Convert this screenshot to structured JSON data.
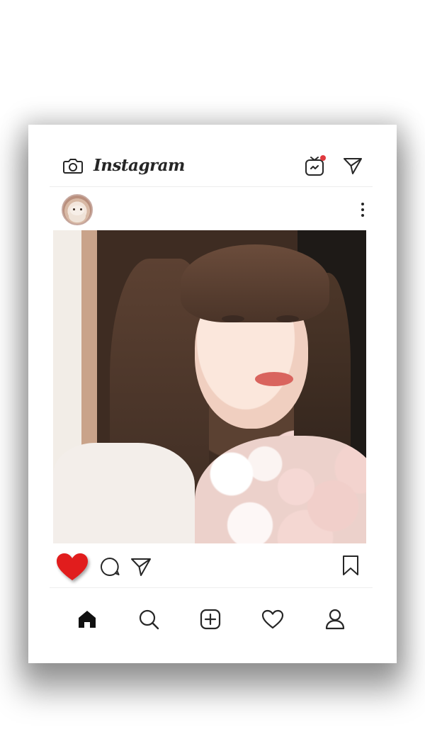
{
  "app": {
    "brand": "Instagram"
  },
  "topbar": {
    "icons": [
      "camera-icon",
      "igtv-icon",
      "direct-message-icon"
    ],
    "notification_dot_color": "#e0393e"
  },
  "post": {
    "liked": true,
    "like_color": "#e11d1d",
    "action_icons": [
      "heart-icon",
      "comment-icon",
      "share-icon",
      "bookmark-icon"
    ]
  },
  "bottom_nav": {
    "items": [
      "home-icon",
      "search-icon",
      "new-post-icon",
      "activity-heart-icon",
      "profile-icon"
    ],
    "active": "home-icon"
  }
}
